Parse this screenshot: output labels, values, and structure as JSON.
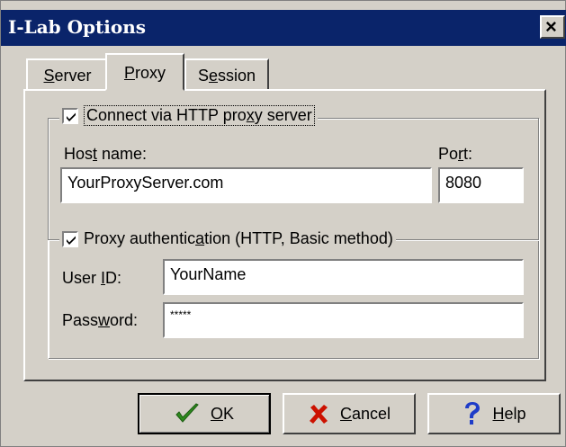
{
  "window": {
    "title": "I-Lab Options",
    "close_glyph": "×"
  },
  "tabs": [
    {
      "label": "Server",
      "mnemonic": "S",
      "rest": "erver"
    },
    {
      "label": "Proxy",
      "mnemonic": "P",
      "rest": "roxy",
      "selected": true
    },
    {
      "label": "Session",
      "pre": "S",
      "mnemonic": "e",
      "rest": "ssion"
    }
  ],
  "proxy": {
    "use_proxy": {
      "checked": true,
      "pre": "Connect via HTTP pro",
      "mnemonic": "x",
      "post": "y server"
    },
    "host": {
      "pre": "Hos",
      "mnemonic": "t",
      "post": " name:",
      "value": "YourProxyServer.com"
    },
    "port": {
      "pre": "Po",
      "mnemonic": "r",
      "post": "t:",
      "value": "8080"
    },
    "auth": {
      "checked": true,
      "pre": "Proxy authentic",
      "mnemonic": "a",
      "post": "tion (HTTP, Basic method)"
    },
    "user": {
      "pre": "User ",
      "mnemonic": "I",
      "post": "D:",
      "value": "YourName"
    },
    "password": {
      "pre": "Pass",
      "mnemonic": "w",
      "post": "ord:",
      "value": "*****"
    }
  },
  "buttons": {
    "ok": {
      "mnemonic": "O",
      "rest": "K",
      "icon": "checkmark-icon",
      "color": "#2e8b1e"
    },
    "cancel": {
      "mnemonic": "C",
      "rest": "ancel",
      "icon": "cross-icon",
      "color": "#cc1100"
    },
    "help": {
      "mnemonic": "H",
      "rest": "elp",
      "icon": "question-icon",
      "color": "#1e3cc8"
    }
  },
  "colors": {
    "titlebar": "#0a246a",
    "face": "#d4d0c8"
  }
}
